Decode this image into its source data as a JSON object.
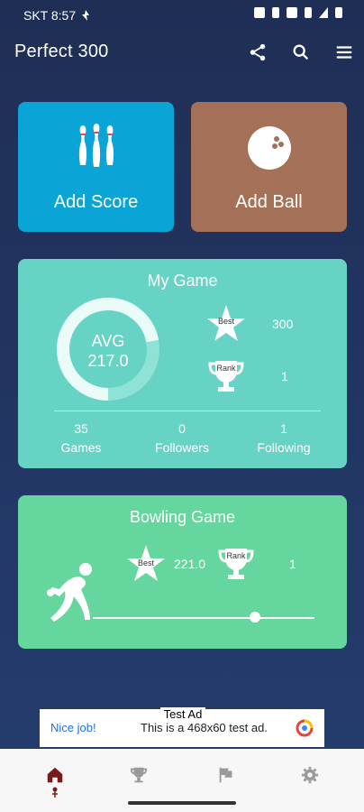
{
  "status": {
    "carrier_time": "SKT 8:57"
  },
  "appbar": {
    "title": "Perfect 300"
  },
  "tiles": {
    "add_score": "Add Score",
    "add_ball": "Add Ball"
  },
  "my_game": {
    "title": "My Game",
    "avg_label": "AVG",
    "avg_value": "217.0",
    "best_badge": "Best",
    "best_value": "300",
    "rank_badge": "Rank",
    "rank_value": "1",
    "games_value": "35",
    "games_label": "Games",
    "followers_value": "0",
    "followers_label": "Followers",
    "following_value": "1",
    "following_label": "Following",
    "avg_ring_fill_fraction": 0.72
  },
  "bowling_game": {
    "title": "Bowling Game",
    "best_badge": "Best",
    "best_value": "221.0",
    "rank_badge": "Rank",
    "rank_value": "1",
    "slider_fraction": 0.73
  },
  "ad": {
    "tag": "Test Ad",
    "nice": "Nice job!",
    "text": "This is a 468x60 test ad."
  },
  "colors": {
    "background": "#1f2e55",
    "add_score": "#0ba4d6",
    "add_ball": "#a57058",
    "my_game": "#67d3c4",
    "bowling_game": "#65d69d"
  },
  "bottom_nav": [
    "home-icon",
    "trophy-icon",
    "flag-icon",
    "gear-icon"
  ]
}
